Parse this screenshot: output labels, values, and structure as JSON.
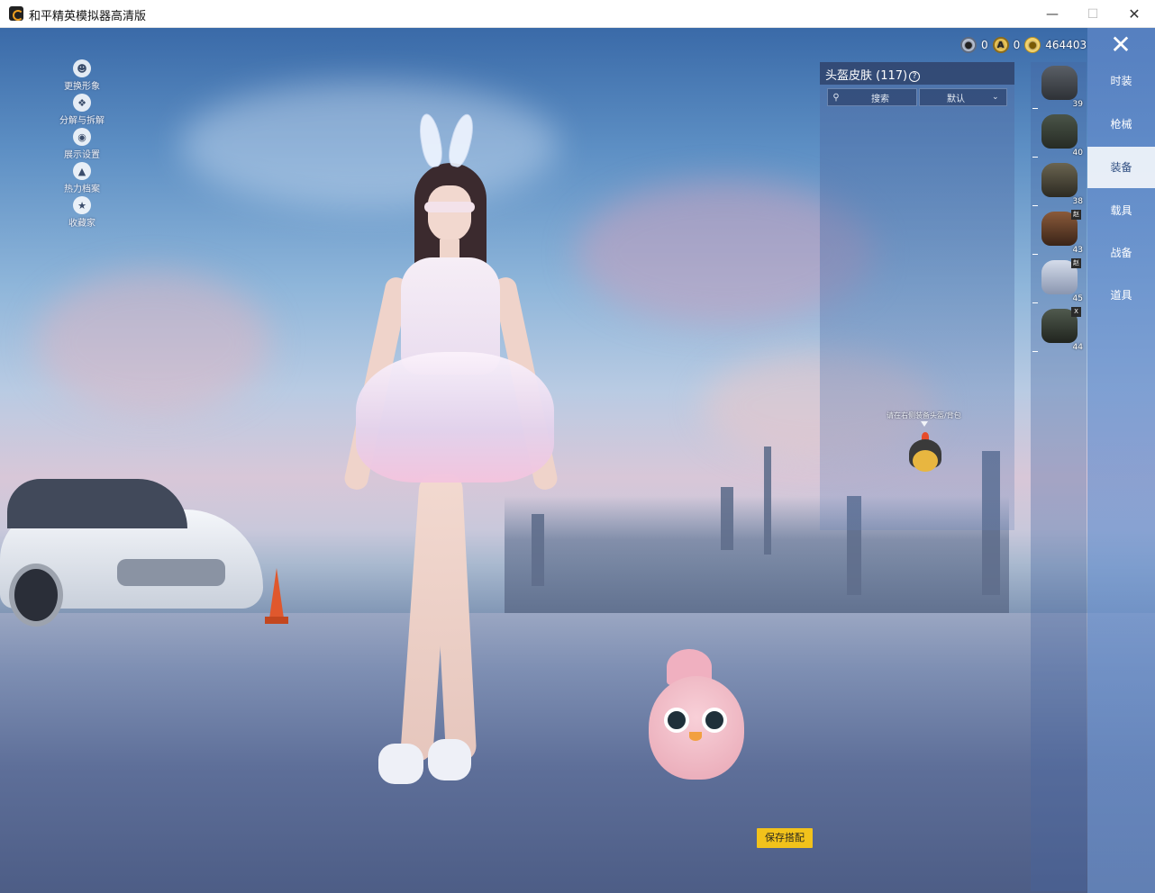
{
  "window": {
    "title": "和平精英模拟器高清版",
    "minimize": "—",
    "maximize": "☐",
    "close": "✕"
  },
  "side_menu": [
    {
      "label": "更换形象",
      "icon": "person-icon"
    },
    {
      "label": "分解与拆解",
      "icon": "puzzle-icon"
    },
    {
      "label": "展示设置",
      "icon": "eye-icon"
    },
    {
      "label": "热力档案",
      "icon": "flame-icon"
    },
    {
      "label": "收藏家",
      "icon": "badge-icon"
    }
  ],
  "currency": {
    "coupons": "0",
    "tokens": "0",
    "coins": "464403"
  },
  "panel": {
    "title": "头盔皮肤 (117)",
    "help": "?",
    "search_label": "搜索",
    "sort_label": "默认"
  },
  "hint": "请在右侧装备头盔/背包",
  "thumbnails": [
    {
      "level": "39",
      "tag": ""
    },
    {
      "level": "40",
      "tag": ""
    },
    {
      "level": "38",
      "tag": ""
    },
    {
      "level": "43",
      "tag": "赵"
    },
    {
      "level": "45",
      "tag": "赵"
    },
    {
      "level": "44",
      "tag": "X"
    }
  ],
  "nav": {
    "close_glyph": "✕",
    "items": [
      "时装",
      "枪械",
      "装备",
      "载具",
      "战备",
      "道具"
    ],
    "active": "装备"
  },
  "save_button": "保存搭配"
}
